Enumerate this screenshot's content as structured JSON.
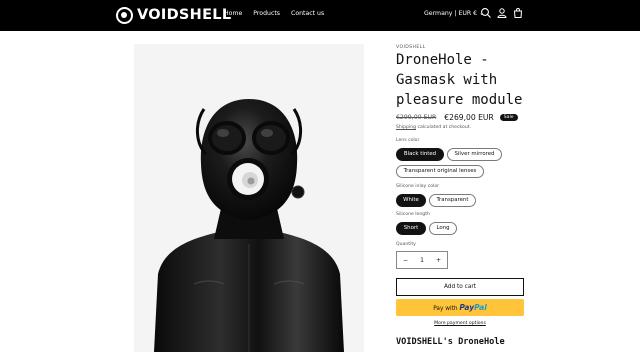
{
  "header": {
    "brand": "VOIDSHELL",
    "nav": [
      "Home",
      "Products",
      "Contact us"
    ],
    "locale": "Germany | EUR € ⌄"
  },
  "product": {
    "vendor": "VOIDSHELL",
    "title": "DroneHole - Gasmask with pleasure module",
    "price_old": "€299,00 EUR",
    "price_new": "€269,00 EUR",
    "sale_badge": "Sale",
    "shipping_link": "Shipping",
    "shipping_rest": " calculated at checkout.",
    "options": {
      "lens_color": {
        "label": "Lens color",
        "values": [
          "Black tinted",
          "Silver mirrored",
          "Transparent original lenses"
        ],
        "selected": "Black tinted"
      },
      "inlay_color": {
        "label": "Silicone inlay color",
        "values": [
          "White",
          "Transparent"
        ],
        "selected": "White"
      },
      "length": {
        "label": "Silicone length",
        "values": [
          "Short",
          "Long"
        ],
        "selected": "Short"
      }
    },
    "quantity": {
      "label": "Quantity",
      "minus": "−",
      "value": "1",
      "plus": "+"
    },
    "add_to_cart": "Add to cart",
    "paypal_prefix": "Pay with",
    "paypal_word1": "Pay",
    "paypal_word2": "Pal",
    "more_payment": "More payment options",
    "description_heading": "VOIDSHELL's DroneHole"
  },
  "colors": {
    "header_bg": "#000000",
    "paypal_yellow": "#ffc439",
    "selected_pill": "#121212"
  }
}
